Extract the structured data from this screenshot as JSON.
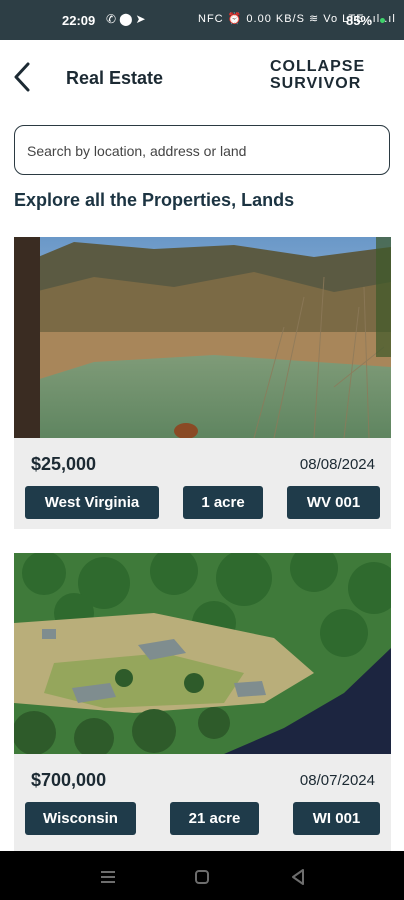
{
  "status_bar": {
    "time": "22:09",
    "left_icons": [
      "phone-icon",
      "location-icon",
      "send-icon"
    ],
    "right_text": "NFC ⏰ 0.00 KB/S ≋ Vo LTE .ıl .ıl",
    "battery": "85%"
  },
  "header": {
    "title": "Real Estate",
    "logo_line1": "COLLAPSE",
    "logo_line2": "SURVIVOR"
  },
  "search": {
    "placeholder": "Search by location, address or land"
  },
  "section_title": "Explore all the Properties, Lands",
  "listings": [
    {
      "price": "$25,000",
      "date": "08/08/2024",
      "state": "West Virginia",
      "size": "1 acre",
      "code": "WV 001"
    },
    {
      "price": "$700,000",
      "date": "08/07/2024",
      "state": "Wisconsin",
      "size": "21 acre",
      "code": "WI 001"
    }
  ],
  "colors": {
    "status_bar": "#2d3e45",
    "tag_bg": "#1f3b4a",
    "card_bg": "#ededed",
    "text_dark": "#1c2a33"
  }
}
